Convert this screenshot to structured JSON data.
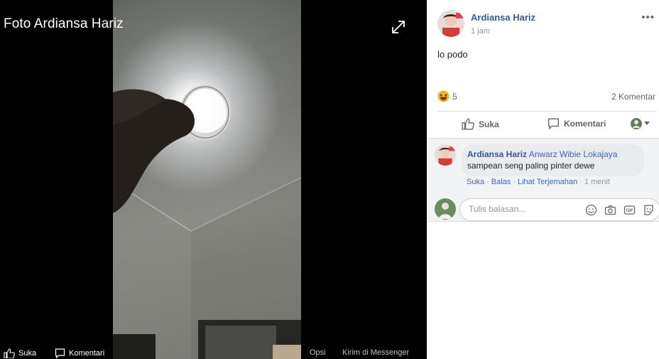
{
  "viewer": {
    "title": "Foto Ardiansa Hariz",
    "bottom": {
      "like_label": "Suka",
      "comment_label": "Komentari",
      "options_label": "Opsi",
      "send_label": "Kirim di Messenger"
    }
  },
  "post": {
    "author": "Ardiansa Hariz",
    "time": "1 jam",
    "more": "•••",
    "text": "lo podo",
    "reaction_count": "5",
    "comments_count": "2 Komentar",
    "actions": {
      "like": "Suka",
      "comment": "Komentari"
    }
  },
  "comment": {
    "author": "Ardiansa Hariz",
    "tagged": "Anwarz Wibie Lokajaya",
    "body": "sampean seng paling pinter dewe",
    "actions": [
      "Suka",
      "Balas",
      "Lihat Terjemahan"
    ],
    "time": "1 menit"
  },
  "reply": {
    "placeholder": "Tulis balasan..."
  },
  "colors": {
    "link": "#385898",
    "muted": "#90949c",
    "reaction": "#f7b125"
  }
}
